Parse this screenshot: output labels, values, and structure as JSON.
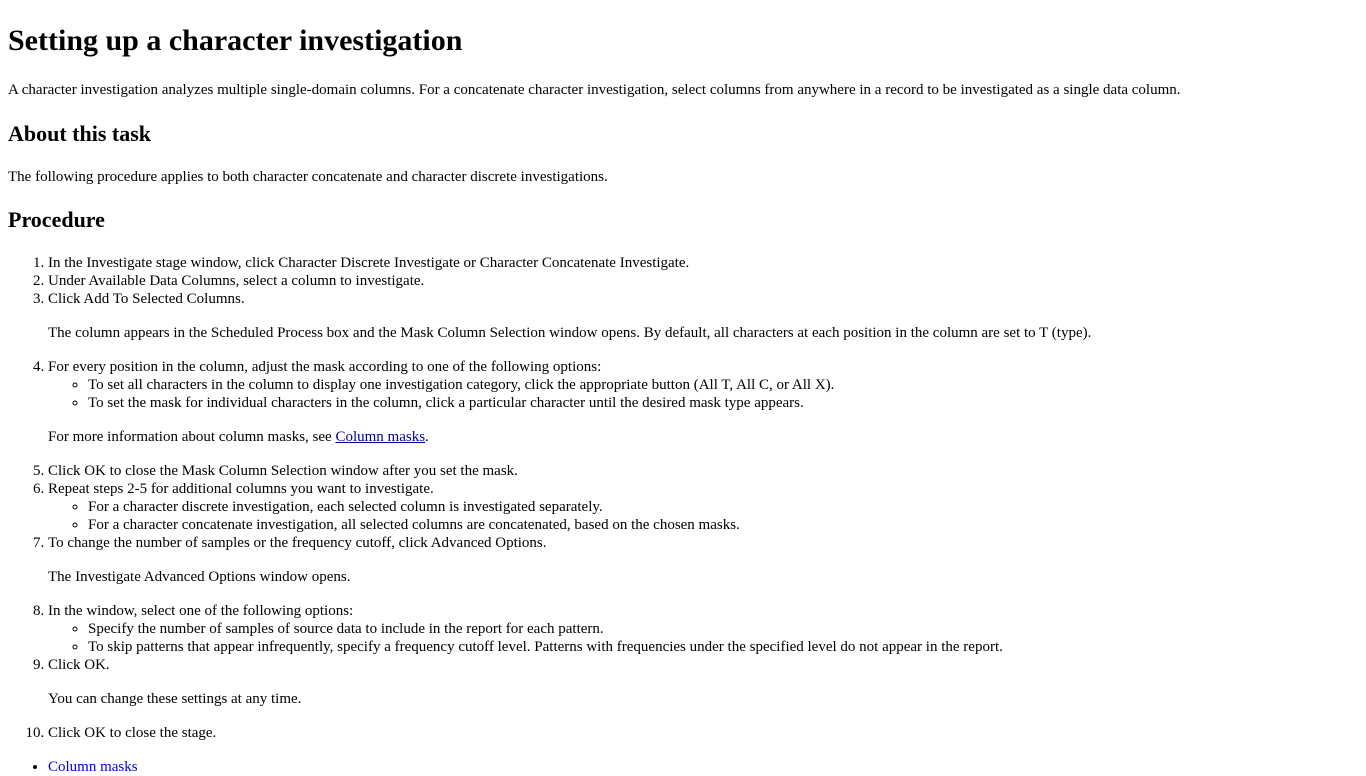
{
  "title": "Setting up a character investigation",
  "intro": "A character investigation analyzes multiple single-domain columns. For a concatenate character investigation, select columns from anywhere in a record to be investigated as a single data column.",
  "about": {
    "heading": "About this task",
    "text": "The following procedure applies to both character concatenate and character discrete investigations."
  },
  "procedure": {
    "heading": "Procedure",
    "steps": [
      {
        "text": "In the Investigate stage window, click Character Discrete Investigate or Character Concatenate Investigate."
      },
      {
        "text": "Under Available Data Columns, select a column to investigate."
      },
      {
        "text": "Click Add To Selected Columns.",
        "info": "The column appears in the Scheduled Process box and the Mask Column Selection window opens. By default, all characters at each position in the column are set to T (type)."
      },
      {
        "text": "For every position in the column, adjust the mask according to one of the following options:",
        "substeps": [
          "To set all characters in the column to display one investigation category, click the appropriate button (All T, All C, or All X).",
          "To set the mask for individual characters in the column, click a particular character until the desired mask type appears."
        ],
        "info_prefix": "For more information about column masks, see ",
        "info_link": "Column masks",
        "info_suffix": "."
      },
      {
        "text": "Click OK to close the Mask Column Selection window after you set the mask."
      },
      {
        "text": "Repeat steps 2-5 for additional columns you want to investigate.",
        "substeps": [
          "For a character discrete investigation, each selected column is investigated separately.",
          "For a character concatenate investigation, all selected columns are concatenated, based on the chosen masks."
        ]
      },
      {
        "text": "To change the number of samples or the frequency cutoff, click Advanced Options.",
        "info": "The Investigate Advanced Options window opens."
      },
      {
        "text": "In the window, select one of the following options:",
        "substeps": [
          "Specify the number of samples of source data to include in the report for each pattern.",
          "To skip patterns that appear infrequently, specify a frequency cutoff level. Patterns with frequencies under the specified level do not appear in the report."
        ]
      },
      {
        "text": "Click OK.",
        "info": "You can change these settings at any time."
      },
      {
        "text": "Click OK to close the stage."
      }
    ]
  },
  "related_links": [
    "Column masks"
  ],
  "colors": {
    "text": "#000000",
    "link_inline": "#0000a0",
    "link_related": "#0000ee"
  }
}
